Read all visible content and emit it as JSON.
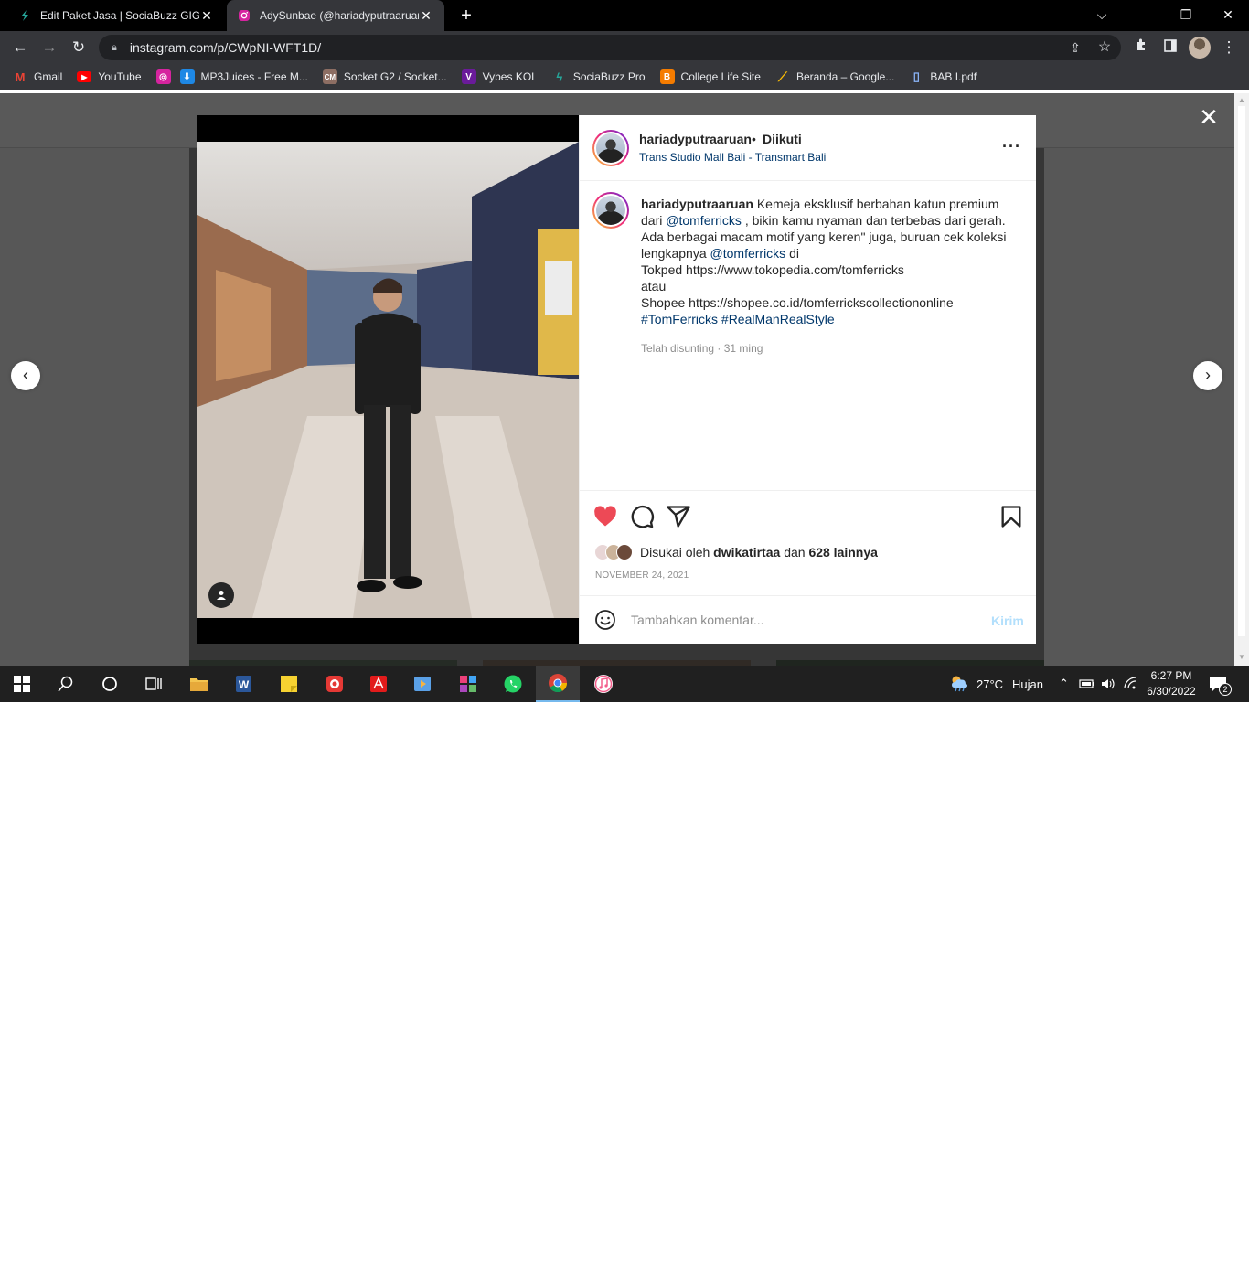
{
  "browser": {
    "tabs": [
      {
        "title": "Edit Paket Jasa | SociaBuzz GIGS",
        "active": false
      },
      {
        "title": "AdySunbae (@hariadyputraaruan",
        "active": true
      }
    ],
    "url": "instagram.com/p/CWpNI-WFT1D/",
    "bookmarks": [
      {
        "label": "Gmail",
        "icon": "gmail-icon",
        "color": "#ea4335"
      },
      {
        "label": "YouTube",
        "icon": "youtube-icon",
        "color": "#ff0000"
      },
      {
        "label": "",
        "icon": "instagram-icon",
        "color": "#d6249f"
      },
      {
        "label": "MP3Juices - Free M...",
        "icon": "download-icon",
        "color": "#1e88e5"
      },
      {
        "label": "Socket G2 / Socket...",
        "icon": "cpu-icon",
        "color": "#8d6e63"
      },
      {
        "label": "Vybes KOL",
        "icon": "vybes-icon",
        "color": "#6a1b9a"
      },
      {
        "label": "SociaBuzz Pro",
        "icon": "sociabuzz-icon",
        "color": "#26a69a"
      },
      {
        "label": "College Life Site",
        "icon": "blogger-icon",
        "color": "#f57c00"
      },
      {
        "label": "Beranda – Google...",
        "icon": "adsense-icon",
        "color": "#fbbc04"
      },
      {
        "label": "BAB I.pdf",
        "icon": "file-icon",
        "color": "#8ab4f8"
      }
    ]
  },
  "post": {
    "username": "hariadyputraaruan",
    "separator": "•",
    "follow_state": "Diikuti",
    "location": "Trans Studio Mall Bali - Transmart Bali",
    "caption": {
      "username": "hariadyputraaruan",
      "line1_text": "Kemeja eksklusif berbahan katun premium dari",
      "mention1": "@tomferricks",
      "line2_text": ", bikin kamu nyaman dan terbebas dari gerah. Ada berbagai macam motif yang keren\" juga, buruan cek koleksi lengkapnya",
      "mention2": "@tomferricks",
      "line3_text": "di",
      "tokped": "Tokped https://www.tokopedia.com/tomferricks",
      "atau": "atau",
      "shopee": "Shopee https://shopee.co.id/tomferrickscollectiononline",
      "hashtag1": "#TomFerricks",
      "hashtag2": "#RealManRealStyle"
    },
    "edited_meta": "Telah disunting · 31 ming",
    "likes": {
      "prefix": "Disukai oleh",
      "user": "dwikatirtaa",
      "connector": "dan",
      "others": "628 lainnya"
    },
    "date": "NOVEMBER 24, 2021",
    "comment_placeholder": "Tambahkan komentar...",
    "send_label": "Kirim",
    "liked": true,
    "like_color": "#ed4956"
  },
  "taskbar": {
    "weather_temp": "27°C",
    "weather_text": "Hujan",
    "time": "6:27 PM",
    "date": "6/30/2022",
    "notifications": "2",
    "apps": [
      "windows-start-icon",
      "search-icon",
      "cortana-icon",
      "task-view-icon",
      "file-explorer-icon",
      "word-icon",
      "sticky-notes-icon",
      "camera-app-icon",
      "acrobat-icon",
      "video-editor-icon",
      "photo-app-icon",
      "whatsapp-icon",
      "chrome-icon",
      "itunes-icon"
    ]
  }
}
